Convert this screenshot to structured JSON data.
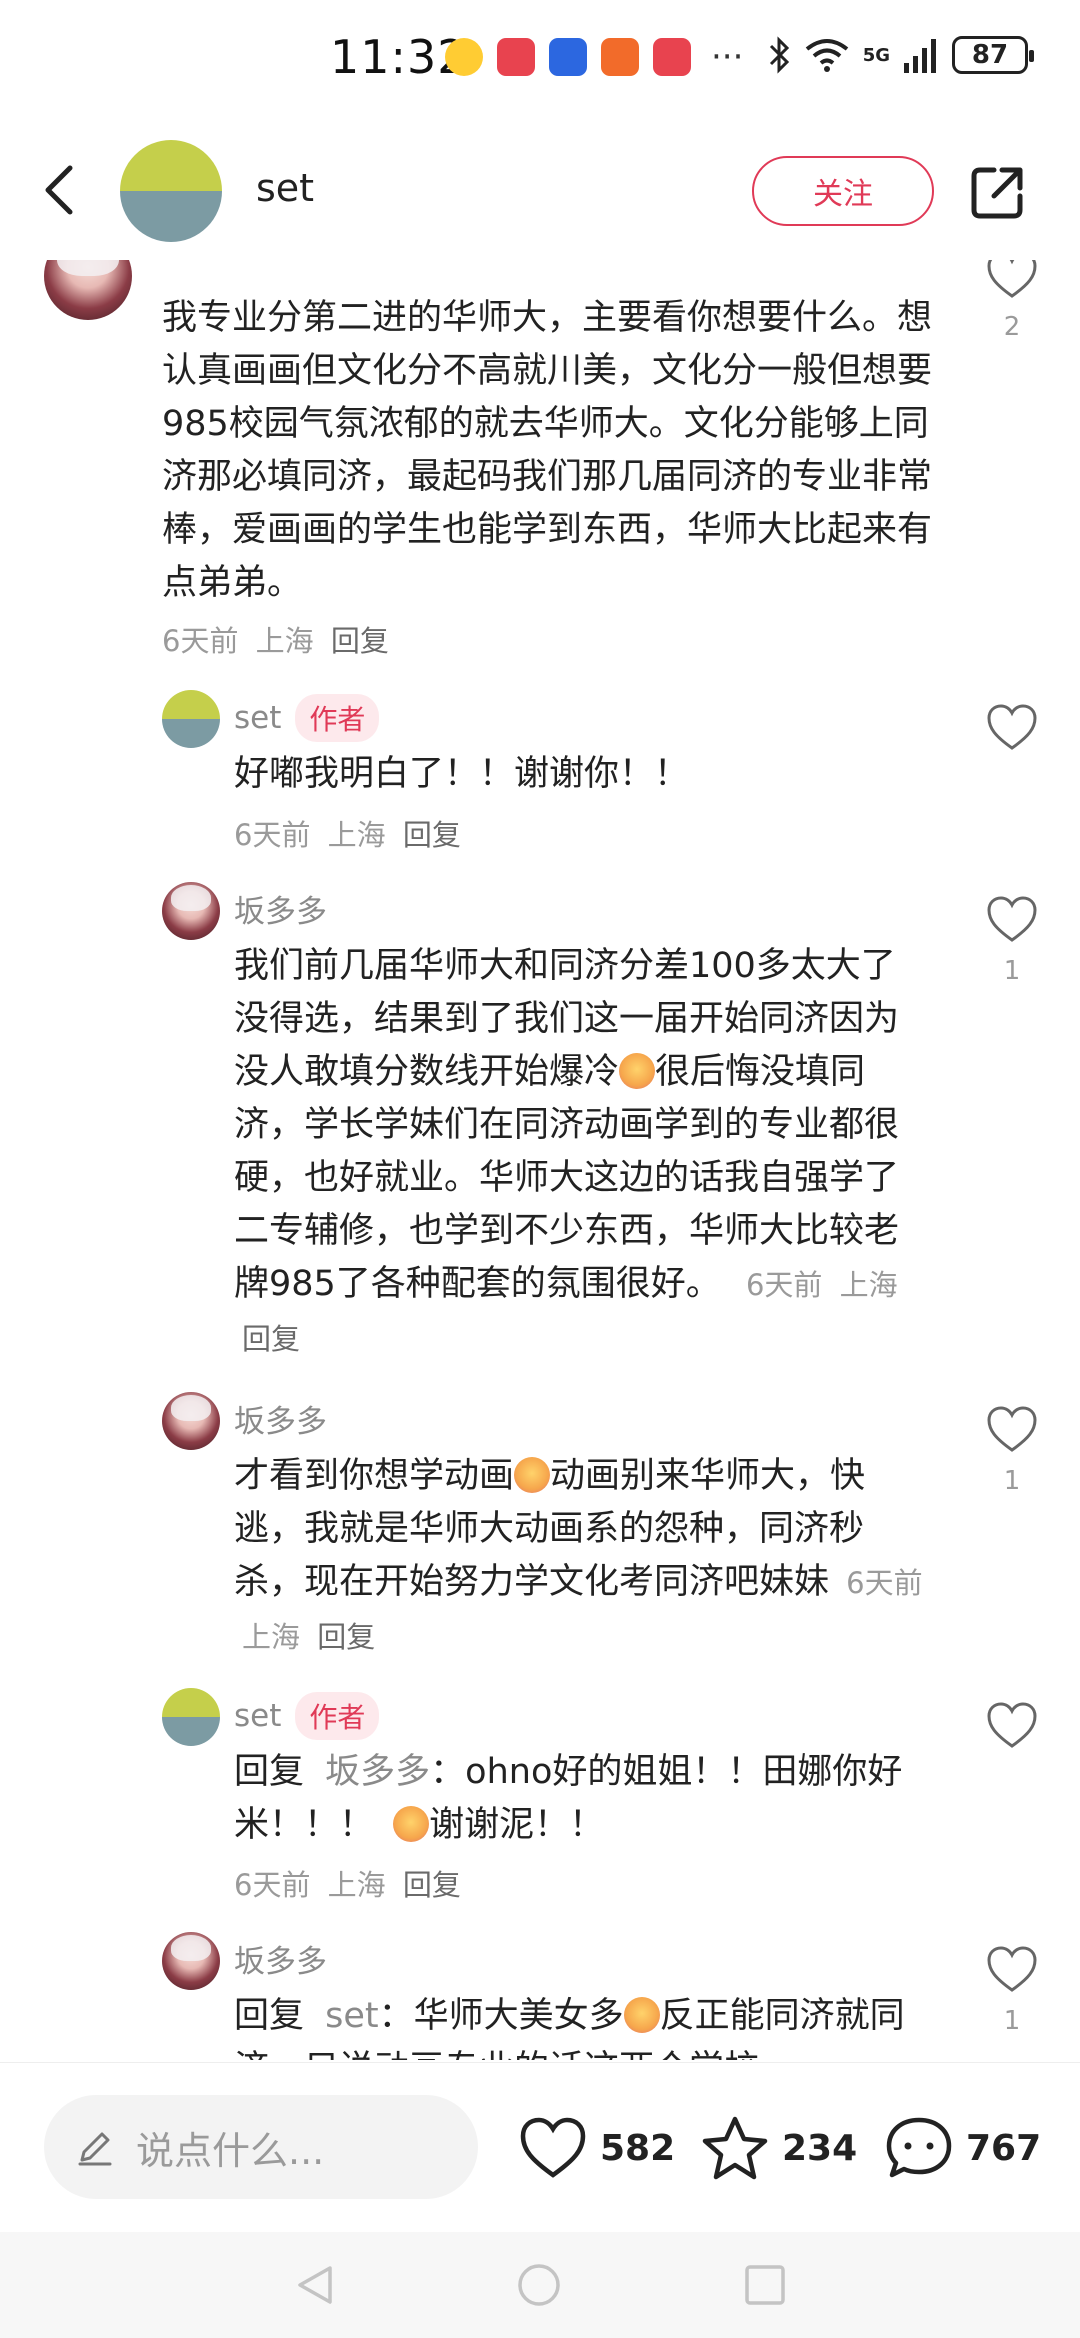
{
  "status_bar": {
    "time": "11:32",
    "network": "5G",
    "battery": "87",
    "overflow": "···"
  },
  "header": {
    "name": "set",
    "follow_label": "关注"
  },
  "comments": {
    "top": {
      "text": "我专业分第二进的华师大，主要看你想要什么。想认真画画但文化分不高就川美，文化分一般但想要985校园气氛浓郁的就去华师大。文化分能够上同济那必填同济，最起码我们那几届同济的专业非常棒，爱画画的学生也能学到东西，华师大比起来有点弟弟。",
      "time": "6天前",
      "location": "上海",
      "reply": "回复",
      "likes": "2"
    },
    "r1": {
      "author": "set",
      "badge": "作者",
      "text": "好嘟我明白了！！谢谢你！！",
      "time": "6天前",
      "location": "上海",
      "reply": "回复"
    },
    "r2": {
      "author": "坂多多",
      "text_a": "我们前几届华师大和同济分差100多太大了没得选，结果到了我们这一届开始同济因为没人敢填分数线开始爆冷",
      "text_b": "很后悔没填同济，学长学妹们在同济动画学到的专业都很硬，也好就业。华师大这边的话我自强学了二专辅修，也学到不少东西，华师大比较老牌985了各种配套的氛围很好。",
      "time": "6天前",
      "location": "上海",
      "reply": "回复",
      "likes": "1"
    },
    "r3": {
      "author": "坂多多",
      "text_a": "才看到你想学动画",
      "text_b": "动画别来华师大，快逃，我就是华师大动画系的怨种，同济秒杀，现在开始努力学文化考同济吧妹妹",
      "time": "6天前",
      "location": "上海",
      "reply": "回复",
      "likes": "1"
    },
    "r4": {
      "author": "set",
      "badge": "作者",
      "reply_prefix": "回复",
      "reply_to": "坂多多",
      "text_a": "：ohno好的姐姐！！田娜你好米！！！",
      "text_b": "谢谢泥！！",
      "time": "6天前",
      "location": "上海",
      "reply": "回复"
    },
    "r5": {
      "author": "坂多多",
      "reply_prefix": "回复",
      "reply_to": "set",
      "text_a": "：华师大美女多",
      "text_b": "反正能同济就同济，只说动画专业的话这两个学校",
      "likes": "1"
    }
  },
  "bottom_bar": {
    "input_placeholder": "说点什么...",
    "likes": "582",
    "stars": "234",
    "comments": "767"
  },
  "colors": {
    "accent": "#e03a57",
    "badge_bg": "#fde9ec",
    "meta": "#9a9a9a"
  }
}
